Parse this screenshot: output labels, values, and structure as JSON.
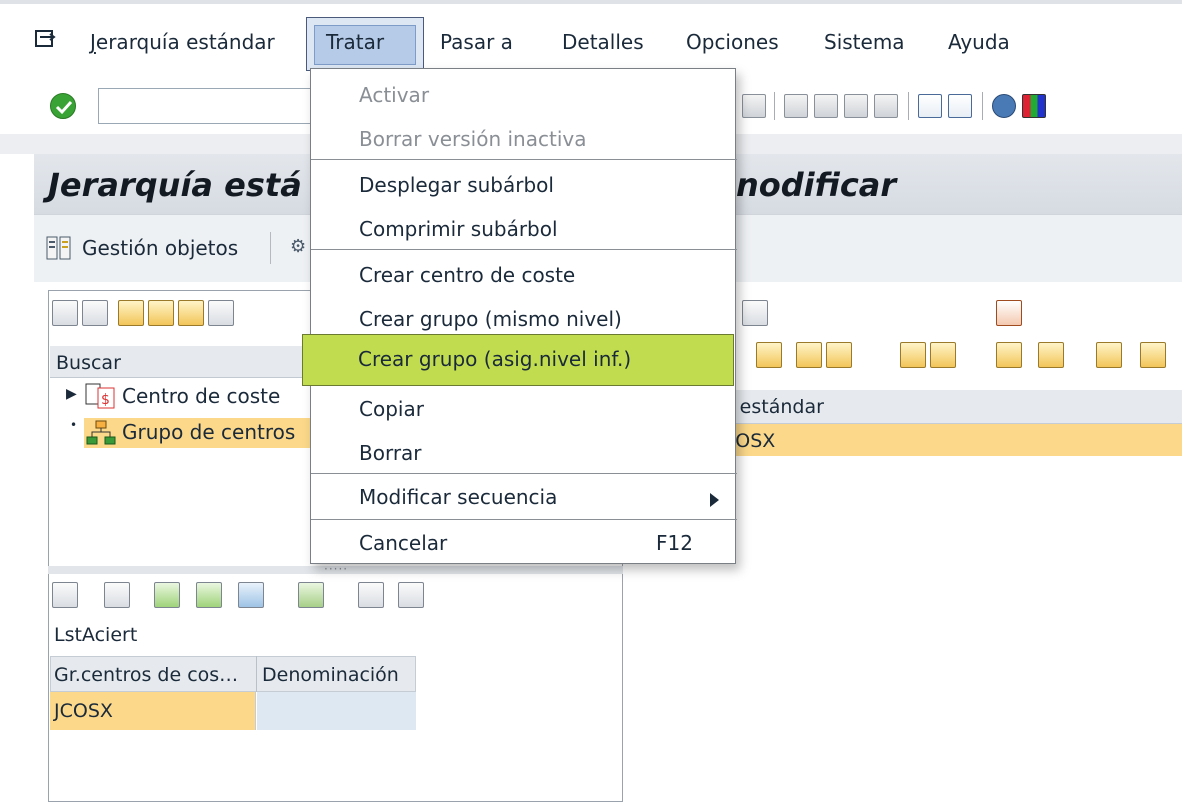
{
  "menubar": {
    "items": [
      {
        "label": "Jerarquía estándar"
      },
      {
        "label": "Tratar"
      },
      {
        "label": "Pasar a"
      },
      {
        "label": "Detalles"
      },
      {
        "label": "Opciones"
      },
      {
        "label": "Sistema"
      },
      {
        "label": "Ayuda"
      }
    ]
  },
  "title": {
    "left": "Jerarquía está",
    "right": "nodificar"
  },
  "app_toolbar": {
    "gestion_label": "Gestión objetos"
  },
  "search_pane": {
    "label": "Buscar",
    "tree": [
      {
        "label": "Centro de coste",
        "icon": "cost-center-icon"
      },
      {
        "label": "Grupo de centros",
        "icon": "hierarchy-icon",
        "selected": true
      }
    ]
  },
  "result_list": {
    "label": "LstAciert",
    "columns": [
      "Gr.centros de cos…",
      "Denominación"
    ],
    "rows": [
      [
        "JCOSX",
        ""
      ]
    ]
  },
  "right_pane": {
    "header": "a estándar",
    "row": "COSX"
  },
  "dropdown": {
    "items": [
      {
        "label": "Activar",
        "disabled": true
      },
      {
        "label": "Borrar versión inactiva",
        "disabled": true
      },
      {
        "label": "Desplegar subárbol"
      },
      {
        "label": "Comprimir subárbol"
      },
      {
        "label": "Crear centro de coste"
      },
      {
        "label": "Crear grupo (mismo nivel)"
      },
      {
        "label": "Crear grupo (asig.nivel inf.)",
        "highlighted": true
      },
      {
        "label": "Copiar"
      },
      {
        "label": "Borrar"
      },
      {
        "label": "Modificar secuencia",
        "submenu": true
      },
      {
        "label": "Cancelar",
        "shortcut": "F12"
      }
    ]
  },
  "colors": {
    "highlight": "#c1dd4f",
    "selection": "#fbd88a",
    "ok_green": "#3aa335"
  }
}
